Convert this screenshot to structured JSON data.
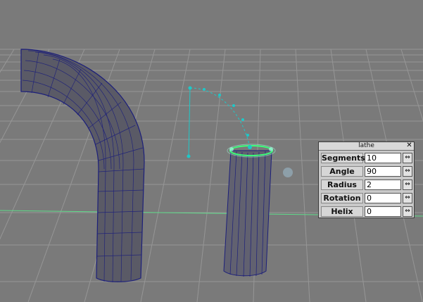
{
  "panel": {
    "title": "lathe",
    "close_glyph": "✕",
    "slider_glyph": "⇔",
    "rows": [
      {
        "label": "Segments",
        "value": "10"
      },
      {
        "label": "Angle",
        "value": "90"
      },
      {
        "label": "Radius",
        "value": "2"
      },
      {
        "label": "Rotation",
        "value": "0"
      },
      {
        "label": "Helix",
        "value": "0"
      }
    ]
  },
  "colors": {
    "background": "#7a7a7a",
    "grid": "#9a9a9a",
    "axis": "#5fdc8a",
    "mesh_fill": "#5a5a66",
    "wire": "#1c1f7a",
    "curve": "#1ec8c8",
    "selection": "#3cff7a"
  },
  "icons": {
    "close": "close-icon",
    "slider": "slider-arrows-icon"
  }
}
